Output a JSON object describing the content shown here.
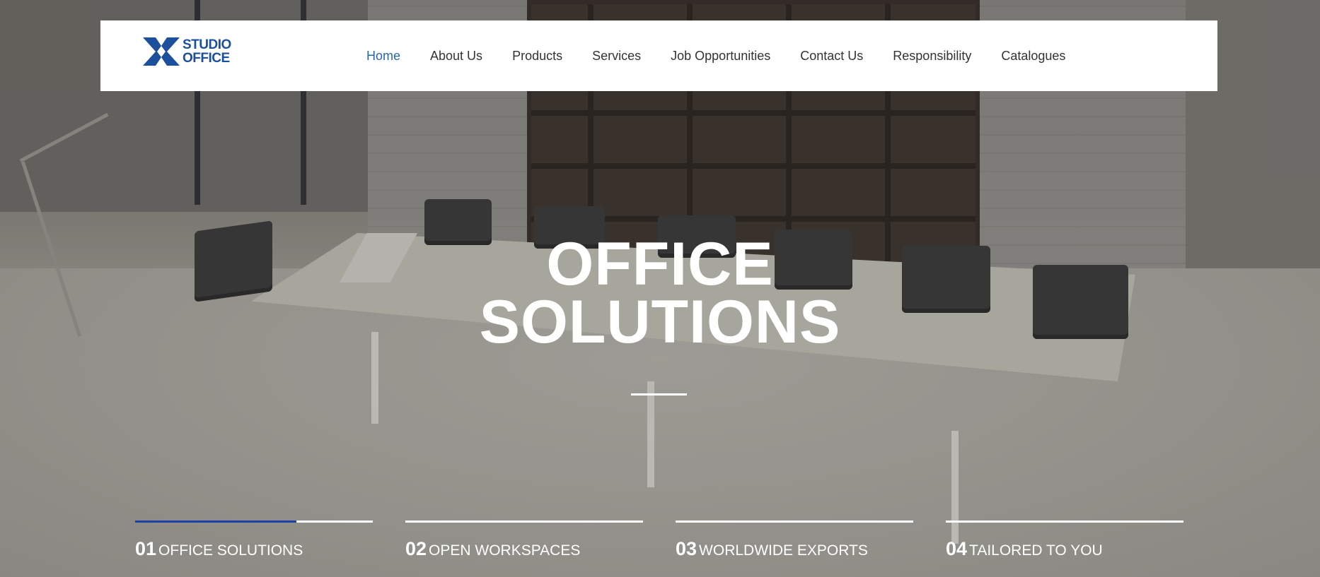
{
  "brand": {
    "line1": "STUDIO",
    "line2": "OFFICE",
    "color": "#1c4f9c"
  },
  "nav": {
    "items": [
      {
        "label": "Home",
        "active": true
      },
      {
        "label": "About Us"
      },
      {
        "label": "Products"
      },
      {
        "label": "Services"
      },
      {
        "label": "Job Opportunities"
      },
      {
        "label": "Contact Us"
      },
      {
        "label": "Responsibility"
      },
      {
        "label": "Catalogues"
      }
    ],
    "active_color": "#2a67a9",
    "text_color": "#333333"
  },
  "hero": {
    "title_line1": "OFFICE",
    "title_line2": "SOLUTIONS"
  },
  "slides": [
    {
      "number": "01",
      "label": "OFFICE SOLUTIONS",
      "progress": 0.68
    },
    {
      "number": "02",
      "label": "OPEN WORKSPACES",
      "progress": 0
    },
    {
      "number": "03",
      "label": "WORLDWIDE EXPORTS",
      "progress": 0
    },
    {
      "number": "04",
      "label": "TAILORED TO YOU",
      "progress": 0
    }
  ],
  "colors": {
    "progress_fill": "#1f3fa8",
    "progress_track": "#ffffff"
  }
}
